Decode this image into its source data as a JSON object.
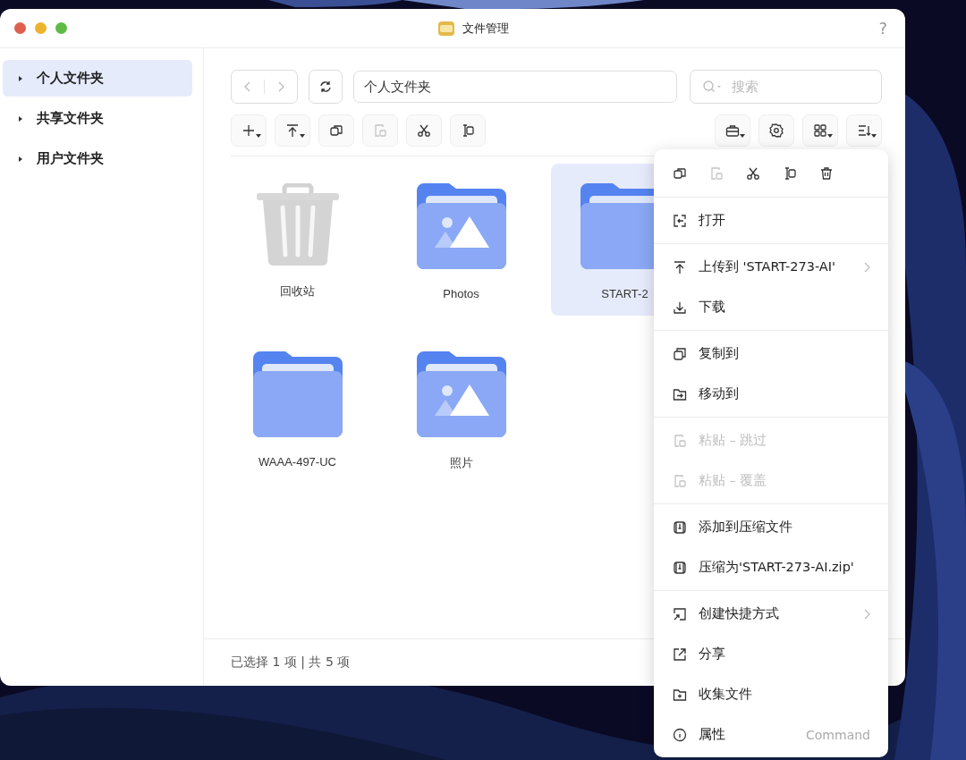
{
  "window": {
    "title": "文件管理",
    "help": "?"
  },
  "sidebar": {
    "items": [
      {
        "label": "个人文件夹",
        "selected": true,
        "expanded": false
      },
      {
        "label": "共享文件夹",
        "selected": false,
        "expanded": false
      },
      {
        "label": "用户文件夹",
        "selected": false,
        "expanded": false
      }
    ]
  },
  "toolbar": {
    "path": "个人文件夹",
    "search": {
      "placeholder": "搜索"
    },
    "left_buttons": [
      {
        "kind": "add",
        "dropdown": true,
        "disabled": false
      },
      {
        "kind": "upload",
        "dropdown": true,
        "disabled": false
      },
      {
        "kind": "copy",
        "dropdown": false,
        "disabled": false
      },
      {
        "kind": "paste",
        "dropdown": false,
        "disabled": true
      },
      {
        "kind": "cut",
        "dropdown": false,
        "disabled": false
      },
      {
        "kind": "rename",
        "dropdown": false,
        "disabled": false
      }
    ],
    "right_buttons": [
      {
        "kind": "briefcase",
        "dropdown": true
      },
      {
        "kind": "settings",
        "dropdown": false
      },
      {
        "kind": "grid",
        "dropdown": true
      },
      {
        "kind": "sort",
        "dropdown": true
      }
    ]
  },
  "files": [
    {
      "name": "回收站",
      "kind": "trash",
      "selected": false
    },
    {
      "name": "Photos",
      "kind": "photo-folder",
      "selected": false
    },
    {
      "name": "START-2",
      "kind": "folder",
      "selected": true
    },
    {
      "name": "WAAA-497-UC",
      "kind": "folder",
      "selected": false
    },
    {
      "name": "照片",
      "kind": "photo-folder",
      "selected": false
    }
  ],
  "status_bar": "已选择 1 项 | 共 5 项",
  "context_menu": {
    "toolbar": [
      {
        "kind": "copy",
        "disabled": false
      },
      {
        "kind": "paste",
        "disabled": true
      },
      {
        "kind": "cut",
        "disabled": false
      },
      {
        "kind": "rename",
        "disabled": false
      },
      {
        "kind": "delete",
        "disabled": false
      }
    ],
    "groups": [
      [
        {
          "label": "打开",
          "kind": "open",
          "disabled": false,
          "submenu": false
        }
      ],
      [
        {
          "label": "上传到 'START-273-AI'",
          "kind": "upload",
          "disabled": false,
          "submenu": true
        },
        {
          "label": "下载",
          "kind": "download",
          "disabled": false,
          "submenu": false
        }
      ],
      [
        {
          "label": "复制到",
          "kind": "copyto",
          "disabled": false,
          "submenu": false
        },
        {
          "label": "移动到",
          "kind": "moveto",
          "disabled": false,
          "submenu": false
        }
      ],
      [
        {
          "label": "粘贴 – 跳过",
          "kind": "paste",
          "disabled": true,
          "submenu": false
        },
        {
          "label": "粘贴 – 覆盖",
          "kind": "paste",
          "disabled": true,
          "submenu": false
        }
      ],
      [
        {
          "label": "添加到压缩文件",
          "kind": "zip",
          "disabled": false,
          "submenu": false
        },
        {
          "label": "压缩为'START-273-AI.zip'",
          "kind": "zip",
          "disabled": false,
          "submenu": false
        }
      ],
      [
        {
          "label": "创建快捷方式",
          "kind": "shortcut",
          "disabled": false,
          "submenu": true
        },
        {
          "label": "分享",
          "kind": "share",
          "disabled": false,
          "submenu": false
        },
        {
          "label": "收集文件",
          "kind": "collect",
          "disabled": false,
          "submenu": false
        },
        {
          "label": "属性",
          "kind": "info",
          "disabled": false,
          "submenu": false,
          "shortcut": "Command"
        }
      ]
    ]
  }
}
